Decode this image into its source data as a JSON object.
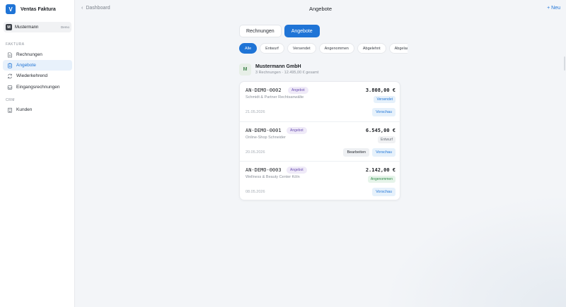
{
  "app": {
    "name": "Ventas Faktura",
    "logo_letter": "V"
  },
  "org": {
    "avatar_letter": "M",
    "name": "Mustermann",
    "tag": "Demo"
  },
  "sidebar": {
    "sections": [
      {
        "label": "FAKTURA"
      },
      {
        "label": "CRM"
      }
    ],
    "items": [
      {
        "label": "Rechnungen",
        "icon": "document-icon"
      },
      {
        "label": "Angebote",
        "icon": "clipboard-icon",
        "active": true
      },
      {
        "label": "Wiederkehrend",
        "icon": "repeat-icon"
      },
      {
        "label": "Eingangsrechnungen",
        "icon": "inbox-icon"
      },
      {
        "label": "Kunden",
        "icon": "building-icon"
      }
    ]
  },
  "header": {
    "back_label": "Dashboard",
    "title": "Angebote",
    "new_label": "+ Neu"
  },
  "segments": [
    {
      "label": "Rechnungen"
    },
    {
      "label": "Angebote",
      "active": true
    }
  ],
  "filters": [
    {
      "label": "Alle",
      "active": true
    },
    {
      "label": "Entwurf"
    },
    {
      "label": "Versendet"
    },
    {
      "label": "Angenommen"
    },
    {
      "label": "Abgelehnt"
    },
    {
      "label": "Abgelau"
    }
  ],
  "customer": {
    "avatar_letter": "M",
    "name": "Mustermann GmbH",
    "summary": "3 Rechnungen · 12.495,00 € gesamt"
  },
  "offers": [
    {
      "number": "AN-DEMO-0002",
      "type": "Angebot",
      "amount": "3.808,00 €",
      "client": "Schmidt & Partner Rechtsanwälte",
      "status": "Versendet",
      "status_kind": "sent",
      "date": "21.05.2026",
      "actions": {
        "preview": "Vorschau"
      }
    },
    {
      "number": "AN-DEMO-0001",
      "type": "Angebot",
      "amount": "6.545,00 €",
      "client": "Online-Shop Schneider",
      "status": "Entwurf",
      "status_kind": "draft",
      "date": "20.05.2026",
      "actions": {
        "edit": "Bearbeiten",
        "preview": "Vorschau"
      }
    },
    {
      "number": "AN-DEMO-0003",
      "type": "Angebot",
      "amount": "2.142,00 €",
      "client": "Wellness & Beauty Center Köln",
      "status": "Angenommen",
      "status_kind": "accepted",
      "date": "08.05.2026",
      "actions": {
        "preview": "Vorschau"
      }
    }
  ],
  "colors": {
    "accent": "#1f74d6",
    "sent": "#1f74d6",
    "draft": "#6a7078",
    "accepted": "#2f8a47",
    "badge": "#6b4fb0"
  }
}
